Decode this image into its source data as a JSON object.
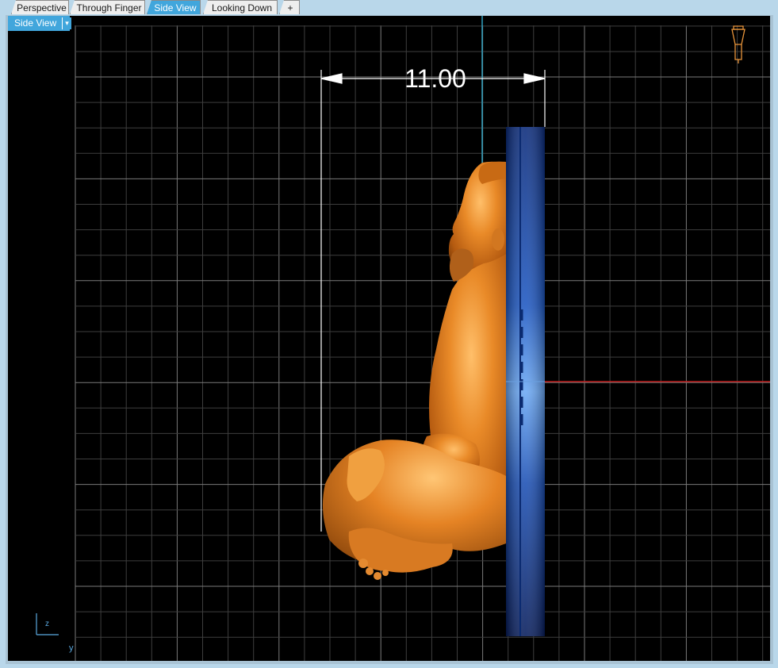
{
  "tabs": [
    {
      "label": "Perspective",
      "active": false
    },
    {
      "label": "Through Finger",
      "active": false
    },
    {
      "label": "Side View",
      "active": true
    },
    {
      "label": "Looking Down",
      "active": false
    }
  ],
  "add_tab_symbol": "+",
  "viewport": {
    "view_name": "Side View",
    "dropdown_symbol": "▾",
    "dimension": "11.00",
    "axis_labels": {
      "vertical": "z",
      "horizontal": "y"
    }
  },
  "colors": {
    "tab_active": "#41a6dc",
    "grid": "#5a5a5a",
    "object": "#d87818",
    "blade": "#1246a8",
    "axis_red": "#c02020",
    "axis_cyan": "#30a0c0"
  },
  "icons": [
    "lamp-icon",
    "axis-triad-icon",
    "add-tab-icon",
    "dropdown-arrow-icon"
  ]
}
